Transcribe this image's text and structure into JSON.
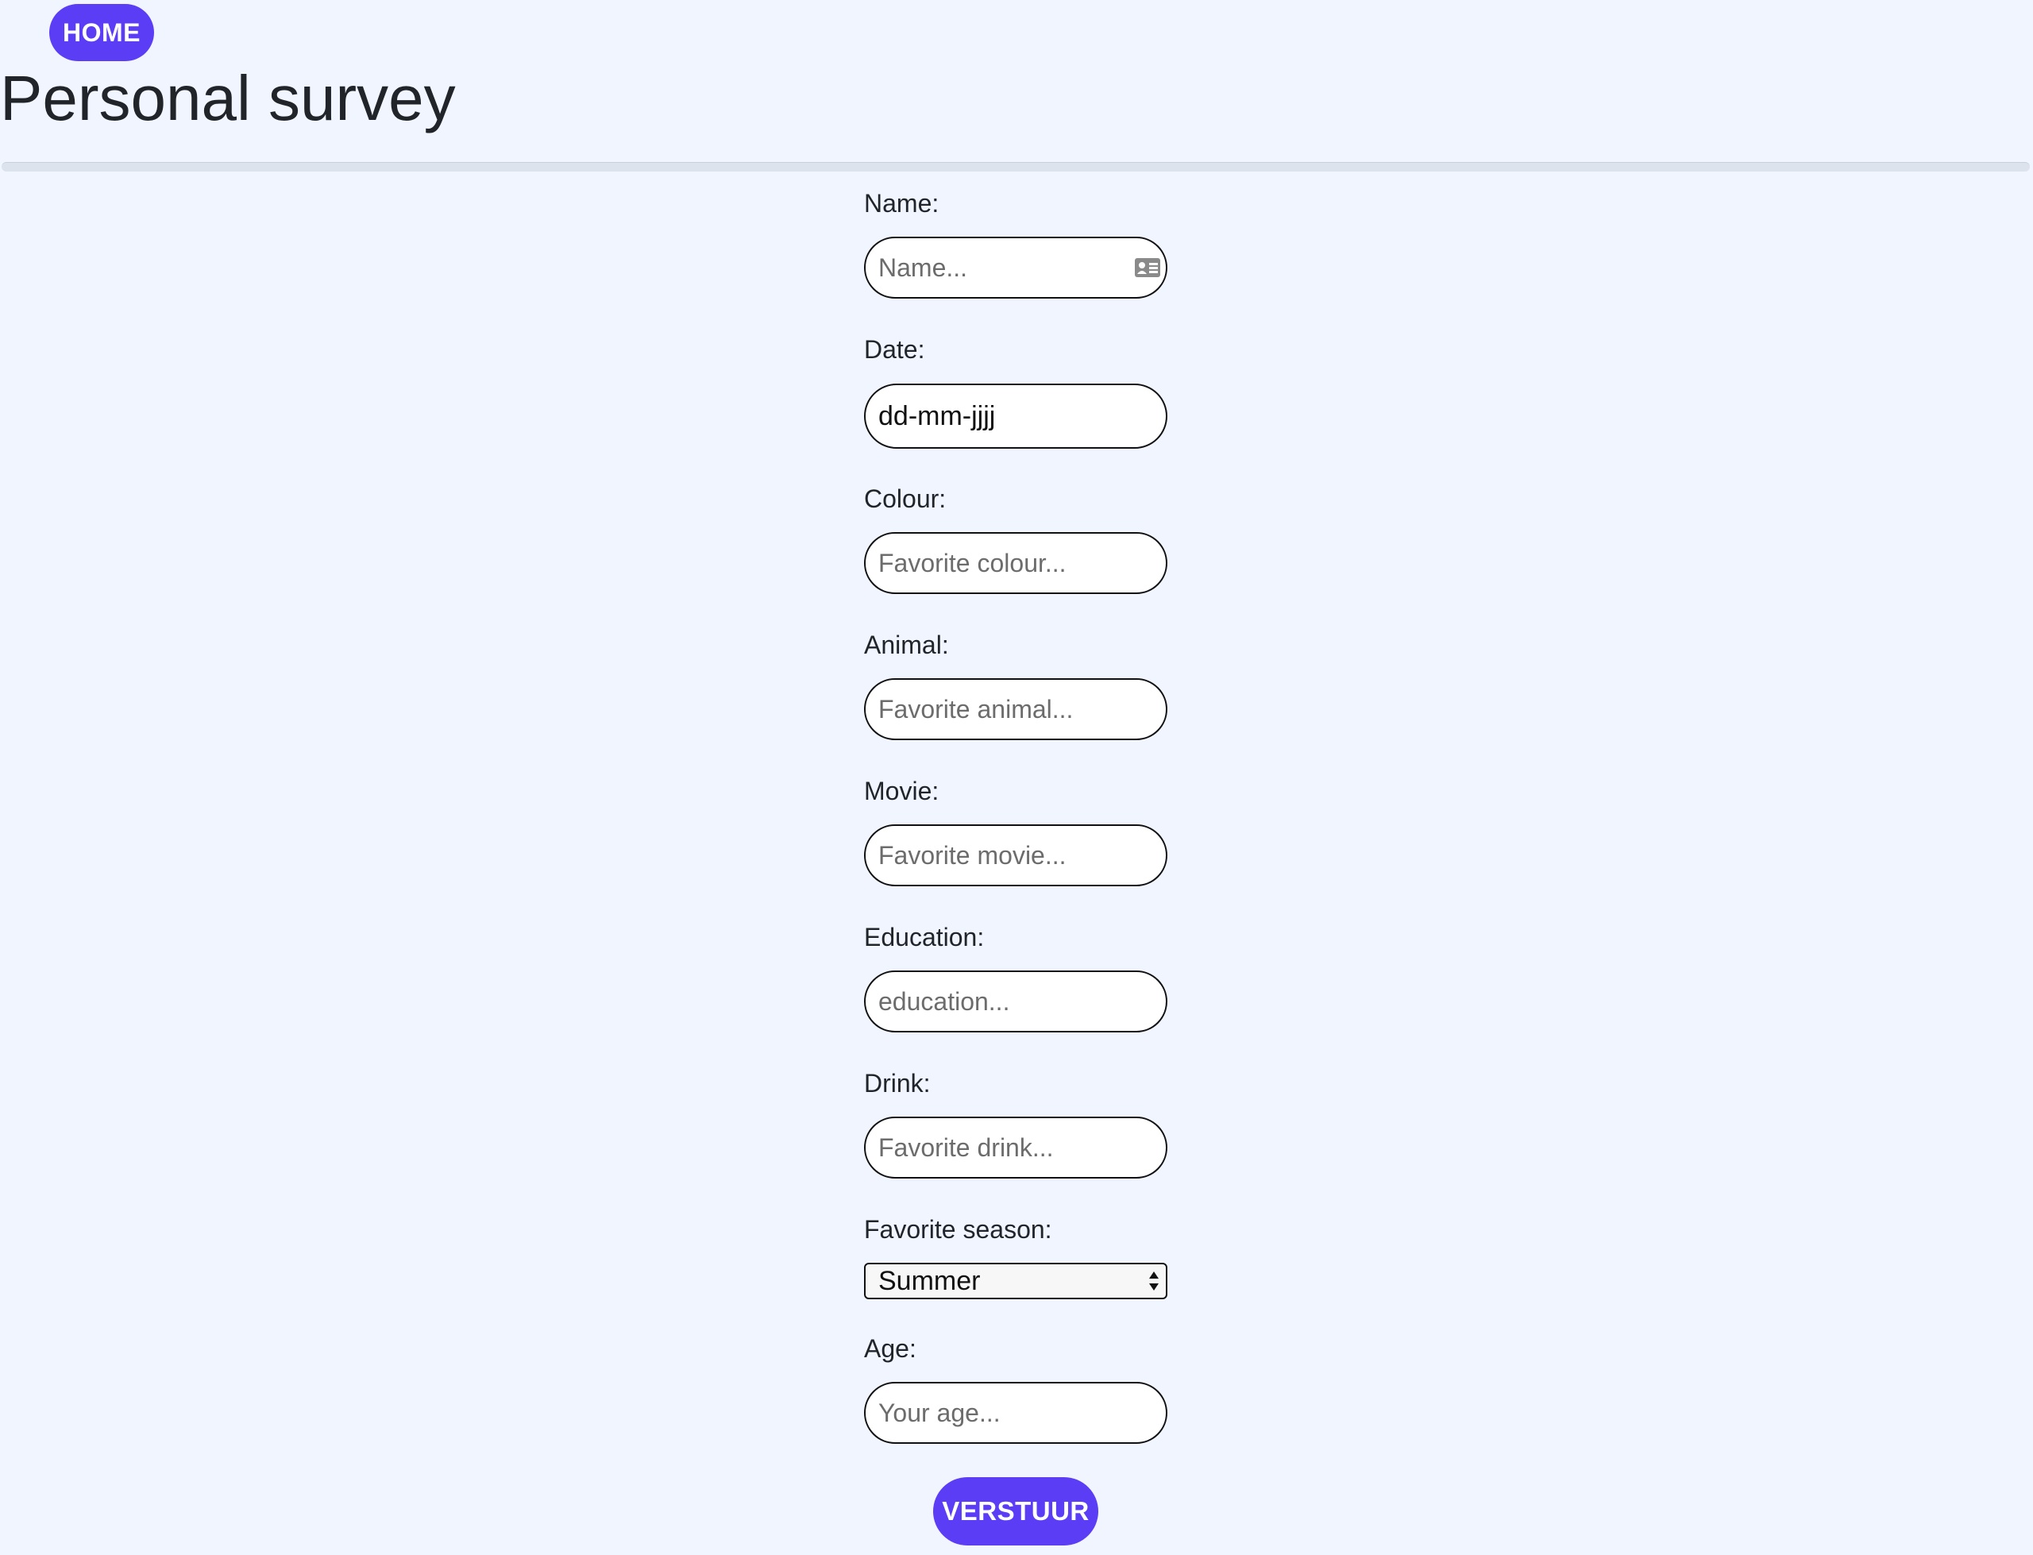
{
  "nav": {
    "home_label": "HOME"
  },
  "page": {
    "title": "Personal survey"
  },
  "form": {
    "name": {
      "label": "Name:",
      "placeholder": "Name..."
    },
    "date": {
      "label": "Date:",
      "value": "dd-mm-jjjj"
    },
    "colour": {
      "label": "Colour:",
      "placeholder": "Favorite colour..."
    },
    "animal": {
      "label": "Animal:",
      "placeholder": "Favorite animal..."
    },
    "movie": {
      "label": "Movie:",
      "placeholder": "Favorite movie..."
    },
    "education": {
      "label": "Education:",
      "placeholder": "education..."
    },
    "drink": {
      "label": "Drink:",
      "placeholder": "Favorite drink..."
    },
    "season": {
      "label": "Favorite season:",
      "value": "Summer"
    },
    "age": {
      "label": "Age:",
      "placeholder": "Your age..."
    },
    "submit_label": "VERSTUUR"
  },
  "colors": {
    "accent": "#5b3df5",
    "background": "#f0f5ff",
    "divider": "#dde3ec"
  },
  "icons": {
    "name_field": "contact-card-icon",
    "season_select": "select-arrows-icon"
  }
}
